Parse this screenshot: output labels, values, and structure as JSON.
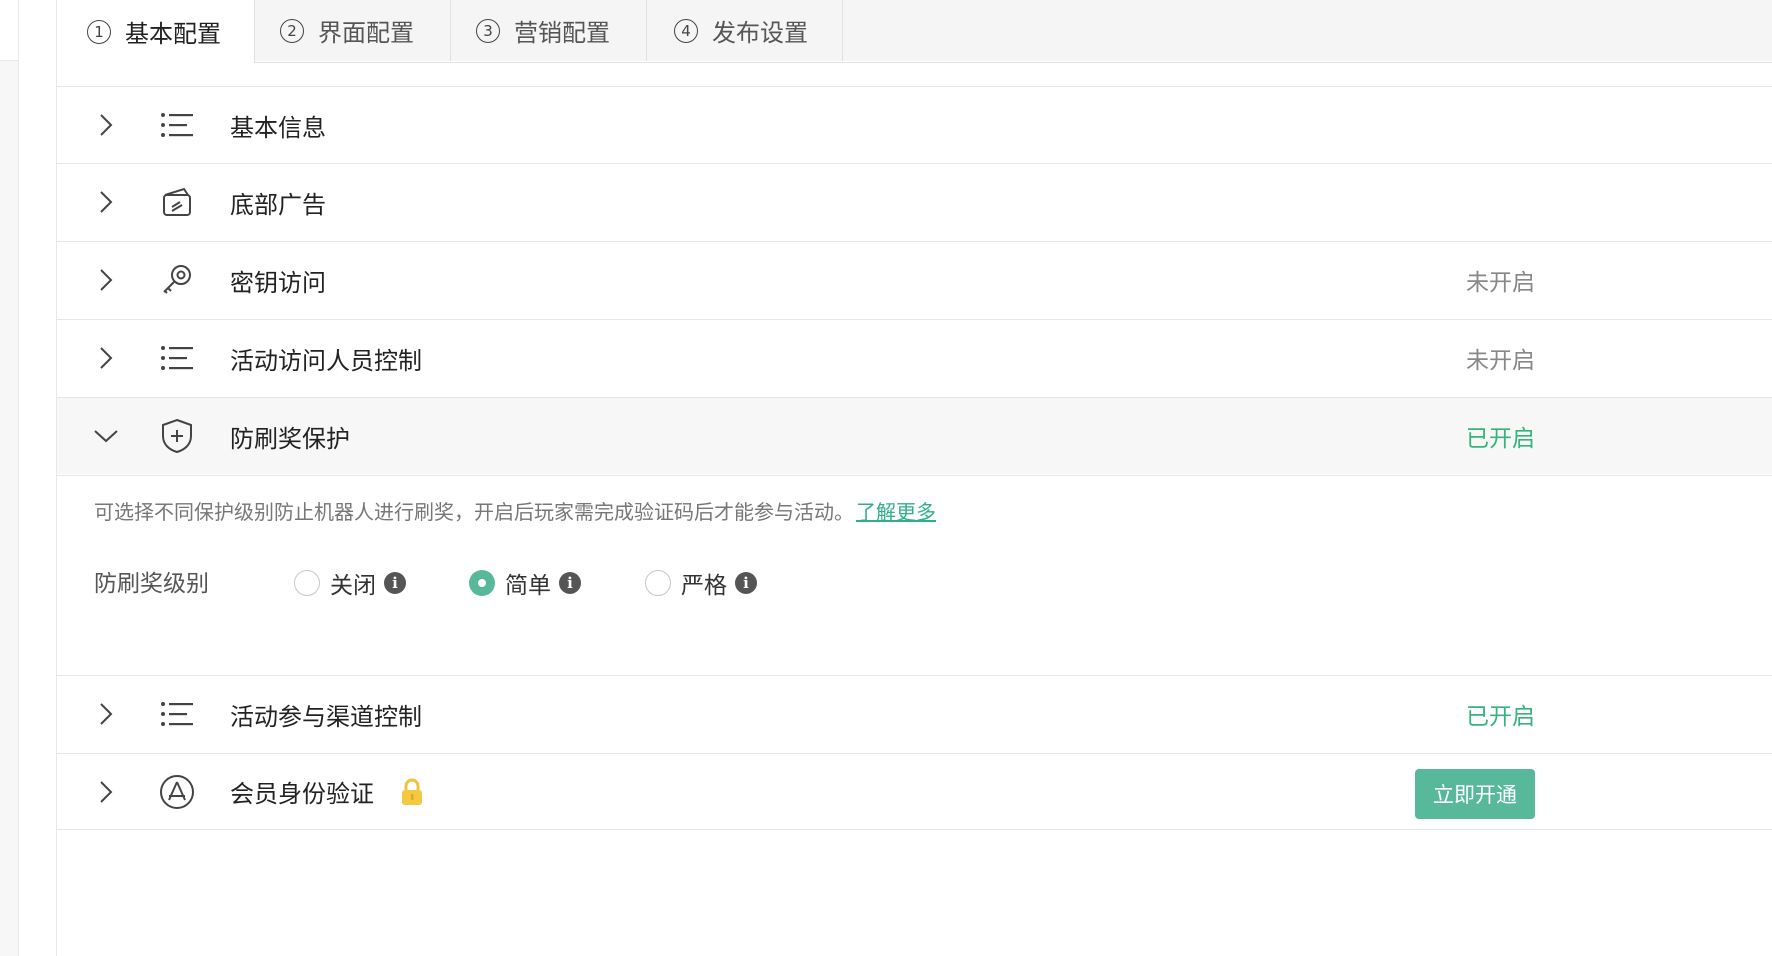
{
  "tabs": [
    {
      "num": "1",
      "label": "基本配置",
      "active": true
    },
    {
      "num": "2",
      "label": "界面配置"
    },
    {
      "num": "3",
      "label": "营销配置"
    },
    {
      "num": "4",
      "label": "发布设置"
    }
  ],
  "sections": [
    {
      "title": "基本信息",
      "icon": "list-icon",
      "status": ""
    },
    {
      "title": "底部广告",
      "icon": "ad-card-icon",
      "status": ""
    },
    {
      "title": "密钥访问",
      "icon": "key-icon",
      "status": "未开启"
    },
    {
      "title": "活动访问人员控制",
      "icon": "list-icon",
      "status": "未开启"
    },
    {
      "title": "防刷奖保护",
      "icon": "shield-plus-icon",
      "status": "已开启",
      "expanded": true
    },
    {
      "title": "活动参与渠道控制",
      "icon": "list-icon",
      "status": "已开启"
    },
    {
      "title": "会员身份验证",
      "icon": "member-badge-icon",
      "button": "立即开通",
      "locked": true
    }
  ],
  "protection": {
    "description": "可选择不同保护级别防止机器人进行刷奖，开启后玩家需完成验证码后才能参与活动。",
    "learn_more": "了解更多",
    "level_label": "防刷奖级别",
    "options": [
      {
        "label": "关闭",
        "checked": false
      },
      {
        "label": "简单",
        "checked": true
      },
      {
        "label": "严格",
        "checked": false
      }
    ]
  },
  "colors": {
    "accent": "#58b99a",
    "status_on": "#36b37e",
    "status_off": "#888888"
  }
}
